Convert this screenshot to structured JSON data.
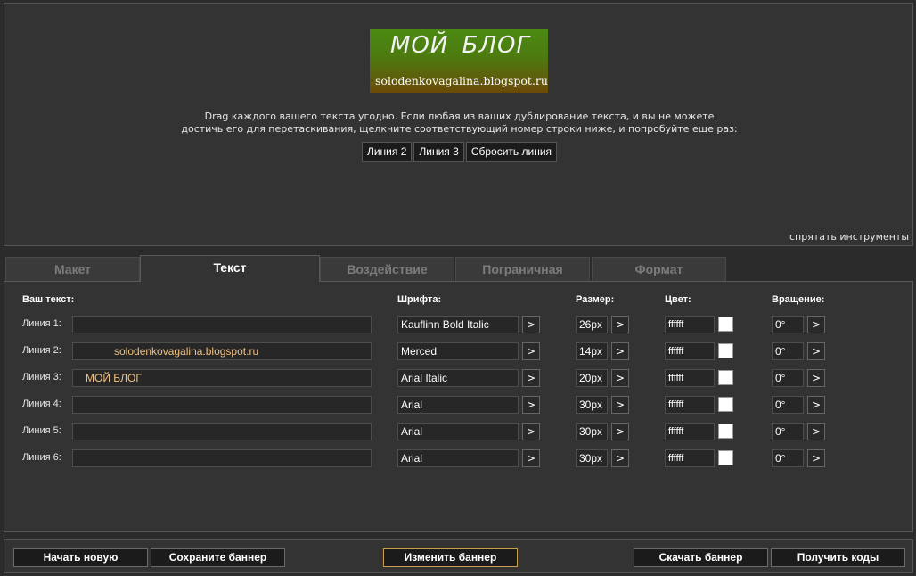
{
  "preview": {
    "banner_title": "МОЙ  БЛОГ",
    "banner_subtitle": "solodenkovagalina.blogspot.ru",
    "instructions_line1": "Drag каждого вашего текста угодно. Если любая из ваших дублирование текста, и вы не можете",
    "instructions_line2": "достичь его для перетаскивания, щелкните соответствующий номер строки ниже, и попробуйте еще раз:",
    "line_buttons": [
      "Линия 2",
      "Линия 3",
      "Сбросить линия"
    ],
    "hide_tools": "спрятать инструменты"
  },
  "tabs": [
    "Макет",
    "Текст",
    "Воздействие",
    "Пограничная",
    "Формат"
  ],
  "active_tab": "Текст",
  "editor": {
    "headers": {
      "text": "Ваш текст:",
      "font": "Шрифта:",
      "size": "Размер:",
      "color": "Цвет:",
      "rotation": "Вращение:"
    },
    "arrow": ">",
    "rows": [
      {
        "label": "Линия 1:",
        "text": "",
        "font": "Kauflinn Bold Italic",
        "size": "26px",
        "color": "ffffff",
        "rotation": "0°"
      },
      {
        "label": "Линия 2:",
        "text": "solodenkovagalina.blogspot.ru",
        "font": "Merced",
        "size": "14px",
        "color": "ffffff",
        "rotation": "0°"
      },
      {
        "label": "Линия 3:",
        "text": "МОЙ  БЛОГ",
        "font": "Arial Italic",
        "size": "20px",
        "color": "ffffff",
        "rotation": "0°"
      },
      {
        "label": "Линия 4:",
        "text": "",
        "font": "Arial",
        "size": "30px",
        "color": "ffffff",
        "rotation": "0°"
      },
      {
        "label": "Линия 5:",
        "text": "",
        "font": "Arial",
        "size": "30px",
        "color": "ffffff",
        "rotation": "0°"
      },
      {
        "label": "Линия 6:",
        "text": "",
        "font": "Arial",
        "size": "30px",
        "color": "ffffff",
        "rotation": "0°"
      }
    ],
    "text_value_color": "#f0c080"
  },
  "footer": {
    "new": "Начать новую",
    "save": "Сохраните баннер",
    "edit": "Изменить баннер",
    "download": "Скачать баннер",
    "codes": "Получить коды"
  },
  "colors": {
    "banner_top": "#4b8a12",
    "banner_bottom": "#6b4a08",
    "edit_border": "#c8a050"
  }
}
